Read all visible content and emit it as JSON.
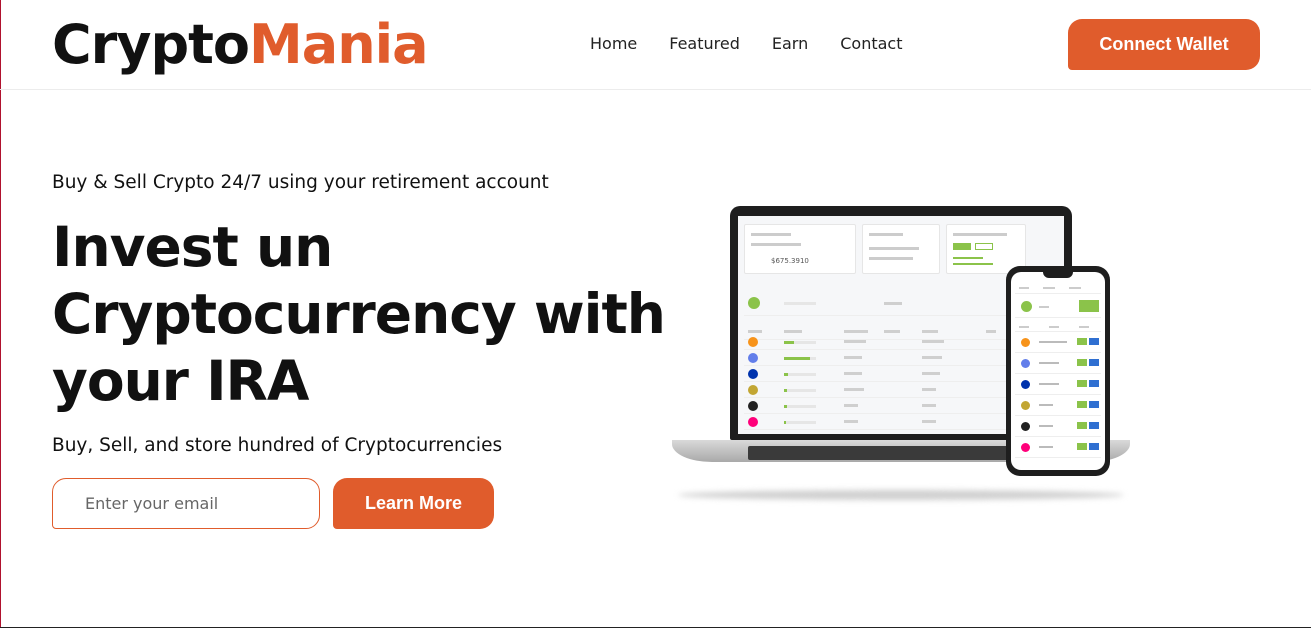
{
  "brand": {
    "part1": "Crypto",
    "part2": "Mania"
  },
  "nav": {
    "items": [
      "Home",
      "Featured",
      "Earn",
      "Contact"
    ]
  },
  "header": {
    "cta_label": "Connect Wallet"
  },
  "hero": {
    "eyebrow": "Buy & Sell Crypto 24/7 using your retirement account",
    "title": "Invest un Cryptocurrency with your IRA",
    "subtitle": "Buy, Sell, and store hundred of Cryptocurrencies",
    "email_placeholder": "Enter your email",
    "cta_label": "Learn More"
  },
  "colors": {
    "accent": "#e05c2c",
    "text": "#111111",
    "coin_green": "#8bc34a"
  },
  "illustration": {
    "portfolio_value": "$675.3910",
    "coins": [
      "Bitcoin",
      "Ethereum",
      "Cardano",
      "Dogecoin",
      "Polkadot",
      "Uniswap"
    ],
    "coin_colors": [
      "#f7931a",
      "#627eea",
      "#0033ad",
      "#c2a633",
      "#222222",
      "#ff007a"
    ]
  }
}
